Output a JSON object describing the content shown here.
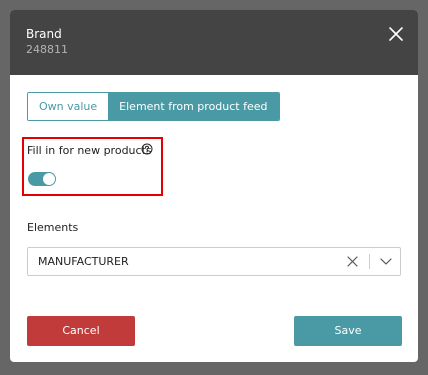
{
  "dialog": {
    "title": "Brand",
    "subtitle": "248811"
  },
  "source_tabs": {
    "own_value": "Own value",
    "product_feed": "Element from product feed",
    "selected": "Element from product feed"
  },
  "fill_new": {
    "label": "Fill in for new products",
    "help_icon": "question-circle-icon",
    "enabled": true
  },
  "elements": {
    "label": "Elements",
    "selected_value": "MANUFACTURER",
    "clear_icon": "close-icon",
    "dropdown_icon": "chevron-down-icon"
  },
  "footer": {
    "cancel_label": "Cancel",
    "save_label": "Save"
  },
  "colors": {
    "accent": "#4a9aa6",
    "danger": "#c23b3b",
    "header": "#444444",
    "highlight": "#e40000"
  }
}
